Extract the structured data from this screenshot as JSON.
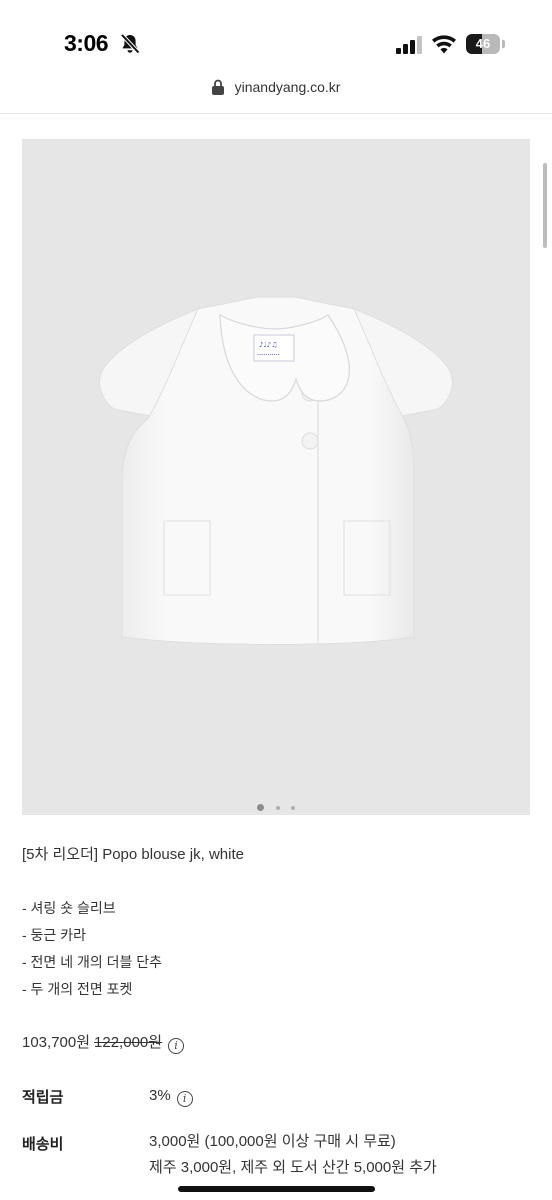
{
  "status_bar": {
    "time": "3:06",
    "battery_level": "46",
    "battery_fraction": 0.46,
    "icons": [
      "bell-slash-icon",
      "signal-icon",
      "wifi-icon",
      "battery-icon"
    ]
  },
  "browser": {
    "url": "yinandyang.co.kr",
    "icon": "lock-icon"
  },
  "product": {
    "image": {
      "background_color": "#e6e6e6",
      "subject": "white-blouse",
      "carousel_index": 1,
      "carousel_count": 3
    },
    "title": "[5차 리오더] Popo blouse jk, white",
    "features": [
      "- 셔링 숏 슬리브",
      "- 둥근 카라",
      "- 전면 네 개의 더블 단추",
      "- 두 개의 전면 포켓"
    ],
    "price": {
      "sale": "103,700원",
      "original": "122,000원",
      "info_icon": "info-icon"
    },
    "points": {
      "label": "적립금",
      "value": "3%",
      "info_icon": "info-icon"
    },
    "shipping": {
      "label": "배송비",
      "line1": "3,000원 (100,000원 이상 구매 시 무료)",
      "line2": "제주 3,000원, 제주 외 도서 산간 5,000원 추가"
    }
  }
}
